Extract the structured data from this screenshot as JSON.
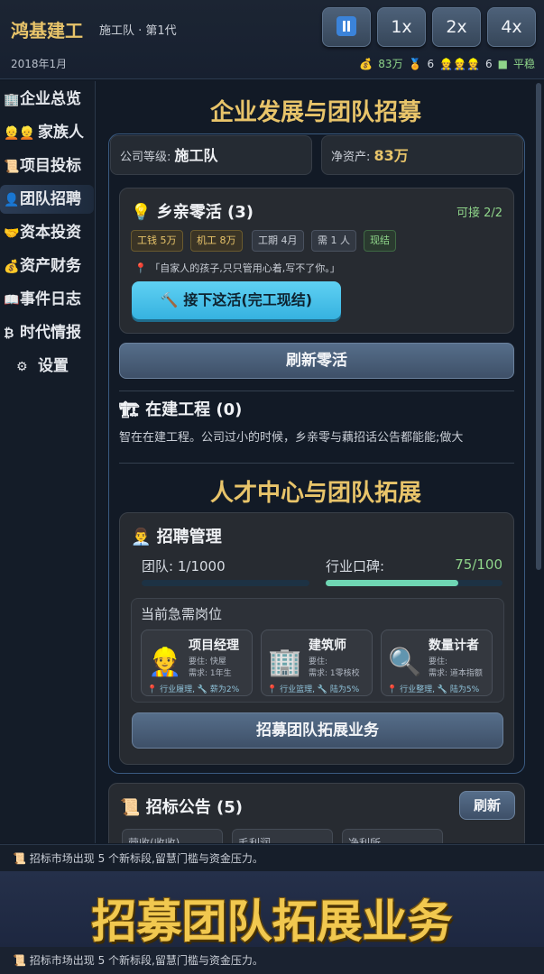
{
  "topbar": {
    "title": "鸿基建工",
    "tier_line": "施工队 · 第1代",
    "date": "2018年1月",
    "speed_buttons": [
      "1x",
      "2x",
      "4x"
    ],
    "stats": {
      "money_icon": "money-bag-icon",
      "money": "83万",
      "medal_icon": "medal-icon",
      "medals": "6",
      "people_icon": "workers-icon",
      "people": "6",
      "status": "平稳"
    }
  },
  "sidebar": {
    "items": [
      {
        "label": "企业总览",
        "icon": "building-icon"
      },
      {
        "label": "家族人",
        "icon": "family-icon"
      },
      {
        "label": "项目投标",
        "icon": "scroll-icon"
      },
      {
        "label": "团队招聘",
        "icon": "person-icon"
      },
      {
        "label": "资本投资",
        "icon": "handshake-icon"
      },
      {
        "label": "资产财务",
        "icon": "money-bag-icon"
      },
      {
        "label": "事件日志",
        "icon": "book-icon"
      },
      {
        "label": "时代情报",
        "icon": "coin-icon"
      },
      {
        "label": "设置",
        "icon": "gear-icon"
      }
    ],
    "active": "团队招聘"
  },
  "main": {
    "section1_title": "企业发展与团队招募",
    "company_level_label": "公司等级:",
    "company_level": "施工队",
    "net_assets_label": "净资产:",
    "net_assets": "83万",
    "gig": {
      "title": "乡亲零活 (3)",
      "availability": "可接 2/2",
      "tags": [
        "工钱 5万",
        "机工 8万",
        "工期 4月",
        "需 1 人",
        "现结"
      ],
      "quote": "「自家人的孩子,只只管用心着,写不了你。」",
      "accept_label": "接下这活(完工现结)"
    },
    "refresh_gig_label": "刷新零活",
    "construction": {
      "title": "在建工程 (0)",
      "note": "智在在建工程。公司过小的时候，乡亲零与藕招话公告都能能;做大"
    },
    "section2_title": "人才中心与团队拓展",
    "recruit": {
      "title": "招聘管理",
      "team_label": "团队:",
      "team_value": "1/1000",
      "reputation_label": "行业口碑:",
      "reputation_value": "75/100",
      "reputation_fraction": 0.75,
      "urgent_label": "当前急需岗位",
      "jobs": [
        {
          "title": "项目经理",
          "line1": "要住: 快屋",
          "line2": "需求: 1年生",
          "foot": "行业履理, 🔧 薪为2%",
          "icon": "worker-helmet-icon"
        },
        {
          "title": "建筑师",
          "line1": "要住:",
          "line2": "需求: 1零核校",
          "foot": "行业篮理, 🔧 陆为5%",
          "icon": "buildings-icon"
        },
        {
          "title": "数量计者",
          "line1": "要住:",
          "line2": "需求: 道本指额",
          "foot": "行业整理, 🔧 陆为5%",
          "icon": "magnifier-icon"
        }
      ],
      "expand_label": "招募团队拓展业务"
    },
    "tender": {
      "title": "招标公告 (5)",
      "refresh_label": "刷新",
      "columns": [
        "营收(收收)",
        "毛利润",
        "净利所"
      ]
    }
  },
  "ticker_text": "招标市场出现 5 个新标段,留慧门槛与资金压力。",
  "banner_text": "招募团队拓展业务"
}
